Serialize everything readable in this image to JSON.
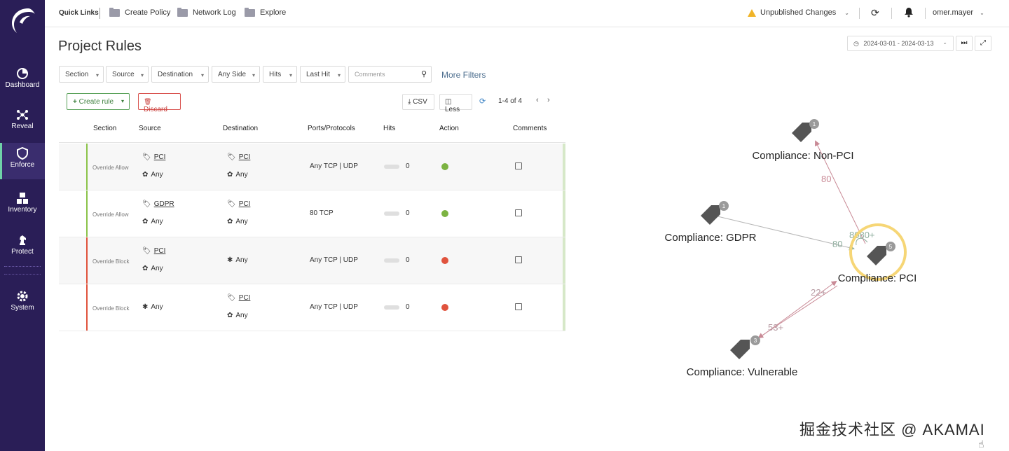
{
  "sidebar": {
    "items": [
      {
        "label": "Dashboard",
        "icon": "pie-chart-icon"
      },
      {
        "label": "Reveal",
        "icon": "network-icon"
      },
      {
        "label": "Enforce",
        "icon": "shield-icon"
      },
      {
        "label": "Inventory",
        "icon": "cubes-icon"
      },
      {
        "label": "Protect",
        "icon": "chess-knight-icon"
      },
      {
        "label": "System",
        "icon": "gear-icon"
      }
    ]
  },
  "topbar": {
    "quick_links": "Quick Links",
    "links": [
      "Create Policy",
      "Network Log",
      "Explore"
    ],
    "unpublished": "Unpublished Changes",
    "user": "omer.mayer"
  },
  "page": {
    "title": "Project Rules",
    "date_range": "2024-03-01 - 2024-03-13"
  },
  "filters": {
    "items": [
      "Section",
      "Source",
      "Destination",
      "Any Side",
      "Hits",
      "Last Hit"
    ],
    "search_placeholder": "Comments",
    "more": "More Filters"
  },
  "toolbar": {
    "create_rule": "Create rule",
    "discard": "Discard",
    "csv": "CSV",
    "less": "Less",
    "pager": "1-4 of 4"
  },
  "table": {
    "headers": [
      "Section",
      "Source",
      "Destination",
      "Ports/Protocols",
      "Hits",
      "Action",
      "Comments"
    ],
    "rows": [
      {
        "section": "Override Allow",
        "source_tag": "PCI",
        "source_any": "Any",
        "dest_tag": "PCI",
        "dest_any": "Any",
        "ports": "Any  TCP | UDP",
        "hits": "0",
        "action": "allow"
      },
      {
        "section": "Override Allow",
        "source_tag": "GDPR",
        "source_any": "Any",
        "dest_tag": "PCI",
        "dest_any": "Any",
        "ports": "80  TCP",
        "hits": "0",
        "action": "allow"
      },
      {
        "section": "Override Block",
        "source_tag": "PCI",
        "source_any": "Any",
        "dest_tag": "",
        "dest_any": "Any",
        "ports": "Any  TCP | UDP",
        "hits": "0",
        "action": "block"
      },
      {
        "section": "Override Block",
        "source_tag": "",
        "source_any": "Any",
        "dest_tag": "PCI",
        "dest_any": "Any",
        "ports": "Any  TCP | UDP",
        "hits": "0",
        "action": "block"
      }
    ]
  },
  "graph": {
    "nodes": [
      {
        "label": "Compliance: Non-PCI",
        "count": "1"
      },
      {
        "label": "Compliance: GDPR",
        "count": "1"
      },
      {
        "label": "Compliance: PCI",
        "count": "5"
      },
      {
        "label": "Compliance: Vulnerable",
        "count": "3"
      }
    ],
    "edges": [
      {
        "label": "80"
      },
      {
        "label": "8080+"
      },
      {
        "label": "80"
      },
      {
        "label": "22+"
      },
      {
        "label": "53+"
      }
    ]
  },
  "watermark": "掘金技术社区 @ AKAMAI"
}
